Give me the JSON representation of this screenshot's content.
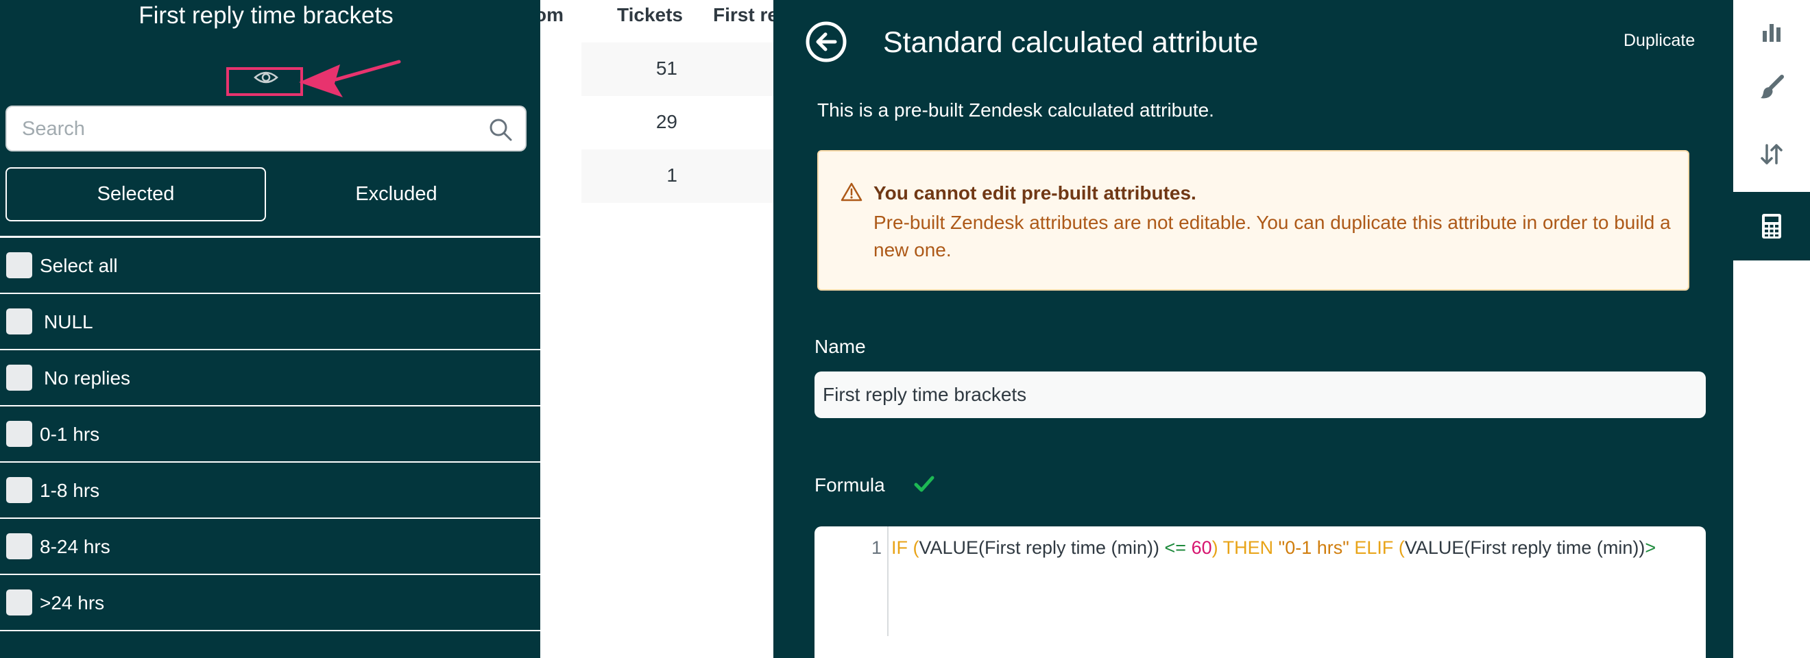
{
  "filter_panel": {
    "title": "First reply time brackets",
    "search_placeholder": "Search",
    "tabs": {
      "selected": "Selected",
      "excluded": "Excluded"
    },
    "items": [
      "Select all",
      "NULL",
      "No replies",
      "0-1 hrs",
      "1-8 hrs",
      "8-24 hrs",
      ">24 hrs"
    ]
  },
  "table": {
    "headers": [
      "om",
      "Tickets",
      "First re"
    ],
    "rows": [
      "51",
      "29",
      "1"
    ]
  },
  "editor": {
    "title": "Standard calculated attribute",
    "duplicate_label": "Duplicate",
    "description": "This is a pre-built Zendesk calculated attribute.",
    "warning": {
      "heading": "You cannot edit pre-built attributes.",
      "text": "Pre-built Zendesk attributes are not editable. You can duplicate this attribute in order to build a new one."
    },
    "name_label": "Name",
    "name_value": "First reply time brackets",
    "formula_label": "Formula",
    "formula": {
      "line_number": "1",
      "tokens": {
        "t1": "IF (",
        "t2": "VALUE(First reply time (min)) ",
        "t3": "<=",
        "t4": " ",
        "t5": "60",
        "t6": ") THEN ",
        "t7": "\"0-1 hrs\"",
        "t8": " ELIF (",
        "t9": "VALUE(First reply time (min))",
        "t10": ">"
      }
    }
  },
  "colors": {
    "panel_bg": "#03363d",
    "highlight": "#e8336e",
    "warning_bg": "#fff8ed",
    "warning_text": "#ad5918",
    "check": "#1db954"
  },
  "icons": [
    "eye-icon",
    "search-icon",
    "back-arrow-icon",
    "warning-icon",
    "check-icon",
    "bar-chart-icon",
    "paintbrush-icon",
    "sort-arrows-icon",
    "calculator-icon"
  ]
}
